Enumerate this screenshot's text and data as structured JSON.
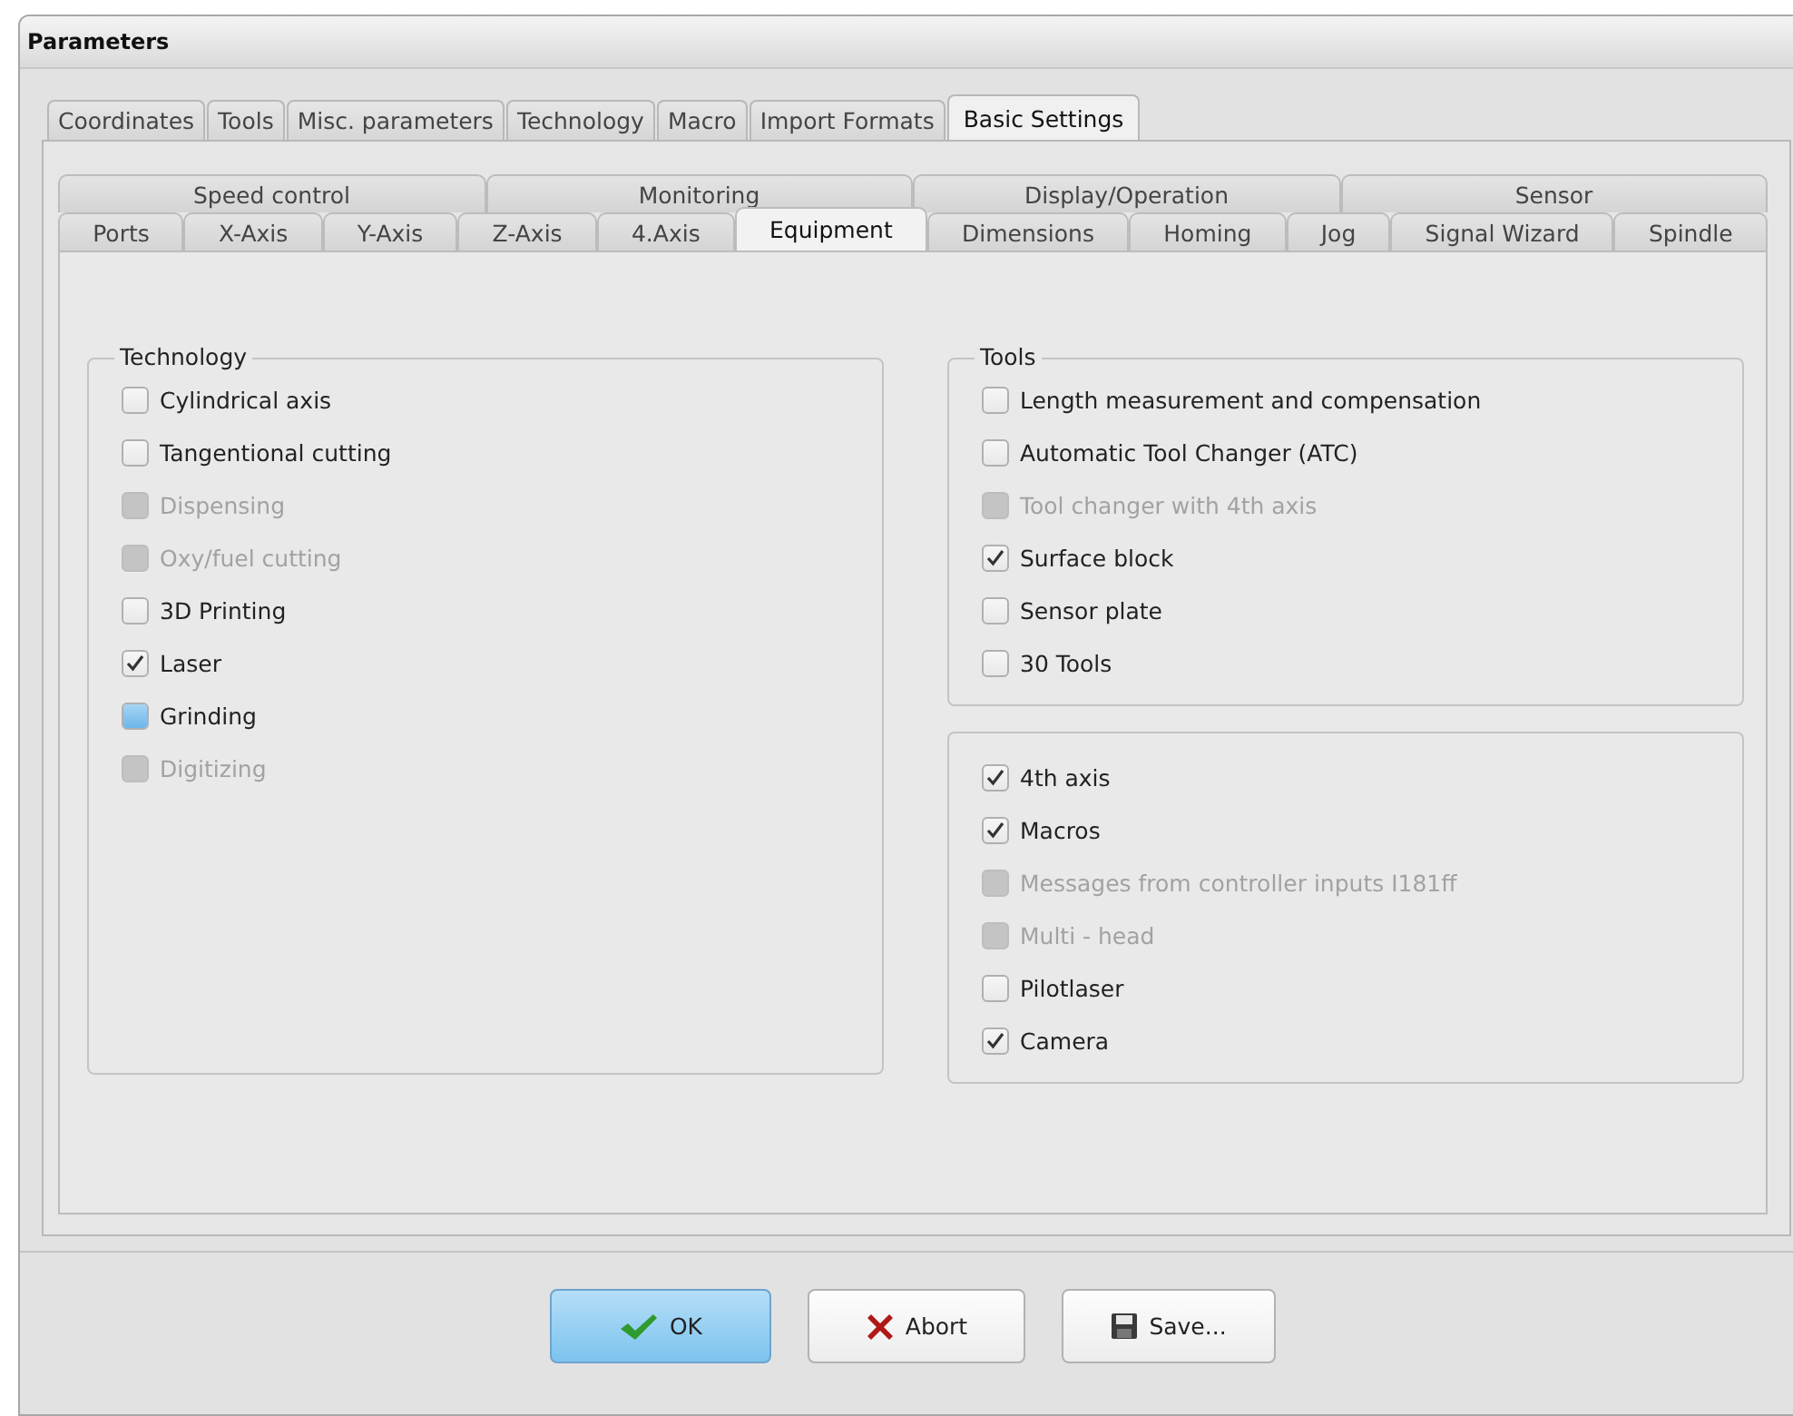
{
  "window": {
    "title": "Parameters"
  },
  "tabs": [
    {
      "label": "Coordinates",
      "selected": false
    },
    {
      "label": "Tools",
      "selected": false
    },
    {
      "label": "Misc. parameters",
      "selected": false
    },
    {
      "label": "Technology",
      "selected": false
    },
    {
      "label": "Macro",
      "selected": false
    },
    {
      "label": "Import Formats",
      "selected": false
    },
    {
      "label": "Basic Settings",
      "selected": true
    }
  ],
  "sub_tabs": [
    {
      "tabs": [
        {
          "label": "Speed control",
          "selected": false
        },
        {
          "label": "Monitoring",
          "selected": false
        },
        {
          "label": "Display/Operation",
          "selected": false
        },
        {
          "label": "Sensor",
          "selected": false
        }
      ]
    },
    {
      "tabs": [
        {
          "label": "Ports",
          "selected": false
        },
        {
          "label": "X-Axis",
          "selected": false
        },
        {
          "label": "Y-Axis",
          "selected": false
        },
        {
          "label": "Z-Axis",
          "selected": false
        },
        {
          "label": "4.Axis",
          "selected": false
        },
        {
          "label": "Equipment",
          "selected": true
        },
        {
          "label": "Dimensions",
          "selected": false
        },
        {
          "label": "Homing",
          "selected": false
        },
        {
          "label": "Jog",
          "selected": false
        },
        {
          "label": "Signal Wizard",
          "selected": false
        },
        {
          "label": "Spindle",
          "selected": false
        }
      ]
    }
  ],
  "columns": [
    {
      "groups": [
        {
          "title": "Technology",
          "options": [
            {
              "label": "Cylindrical axis",
              "checked": false,
              "disabled": false,
              "hovered": false
            },
            {
              "label": "Tangentional cutting",
              "checked": false,
              "disabled": false,
              "hovered": false
            },
            {
              "label": "Dispensing",
              "checked": false,
              "disabled": true,
              "hovered": false
            },
            {
              "label": "Oxy/fuel cutting",
              "checked": false,
              "disabled": true,
              "hovered": false
            },
            {
              "label": "3D Printing",
              "checked": false,
              "disabled": false,
              "hovered": false
            },
            {
              "label": "Laser",
              "checked": true,
              "disabled": false,
              "hovered": false
            },
            {
              "label": "Grinding",
              "checked": false,
              "disabled": false,
              "hovered": true
            },
            {
              "label": "Digitizing",
              "checked": false,
              "disabled": true,
              "hovered": false
            }
          ]
        }
      ]
    },
    {
      "groups": [
        {
          "title": "Tools",
          "options": [
            {
              "label": "Length measurement and compensation",
              "checked": false,
              "disabled": false,
              "hovered": false
            },
            {
              "label": "Automatic Tool Changer (ATC)",
              "checked": false,
              "disabled": false,
              "hovered": false
            },
            {
              "label": "Tool changer with 4th axis",
              "checked": false,
              "disabled": true,
              "hovered": false
            },
            {
              "label": "Surface block",
              "checked": true,
              "disabled": false,
              "hovered": false
            },
            {
              "label": "Sensor plate",
              "checked": false,
              "disabled": false,
              "hovered": false
            },
            {
              "label": "30 Tools",
              "checked": false,
              "disabled": false,
              "hovered": false
            }
          ]
        },
        {
          "options": [
            {
              "label": "4th axis",
              "checked": true,
              "disabled": false,
              "hovered": false
            },
            {
              "label": "Macros",
              "checked": true,
              "disabled": false,
              "hovered": false
            },
            {
              "label": "Messages from controller inputs I181ff",
              "checked": false,
              "disabled": true,
              "hovered": false
            },
            {
              "label": "Multi - head",
              "checked": false,
              "disabled": true,
              "hovered": false
            },
            {
              "label": "Pilotlaser",
              "checked": false,
              "disabled": false,
              "hovered": false
            },
            {
              "label": "Camera",
              "checked": true,
              "disabled": false,
              "hovered": false
            }
          ]
        }
      ]
    }
  ],
  "buttons": [
    {
      "label": "OK",
      "kind": "ok",
      "default": true
    },
    {
      "label": "Abort",
      "kind": "abort",
      "default": false
    },
    {
      "label": "Save...",
      "kind": "save",
      "default": false
    }
  ]
}
